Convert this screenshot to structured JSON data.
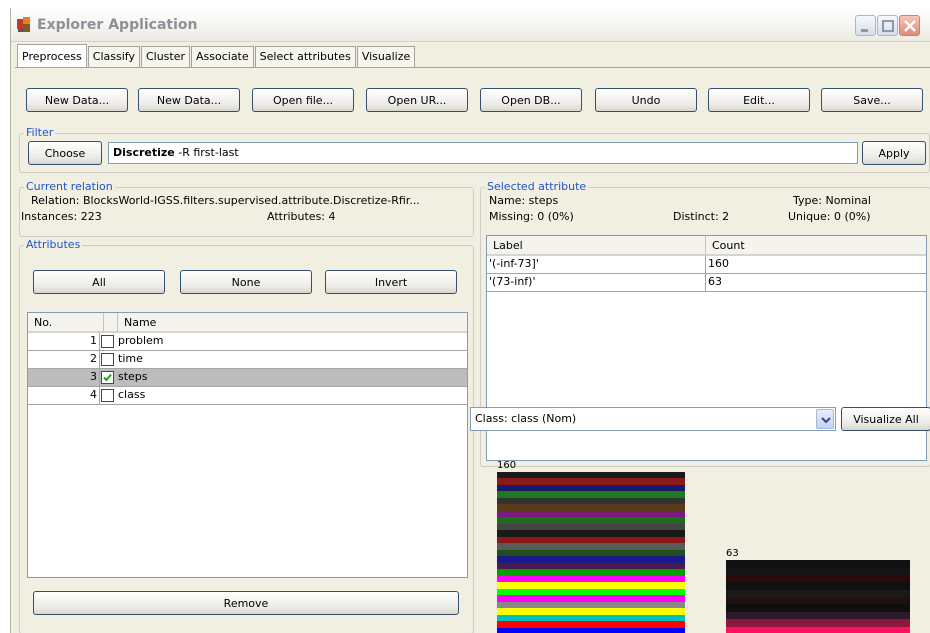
{
  "window": {
    "title": "Explorer Application"
  },
  "tabs": [
    {
      "label": "Preprocess",
      "active": true
    },
    {
      "label": "Classify"
    },
    {
      "label": "Cluster"
    },
    {
      "label": "Associate"
    },
    {
      "label": "Select attributes"
    },
    {
      "label": "Visualize"
    }
  ],
  "toolbar": {
    "buttons": [
      "New Data...",
      "New Data...",
      "Open file...",
      "Open UR...",
      "Open DB...",
      "Undo",
      "Edit...",
      "Save..."
    ]
  },
  "filter": {
    "title": "Filter",
    "choose_label": "Choose",
    "name": "Discretize",
    "options": " -R first-last",
    "apply_label": "Apply"
  },
  "current_relation": {
    "title": "Current relation",
    "relation_text": "Relation: BlocksWorld-IGSS.filters.supervised.attribute.Discretize-Rfir...",
    "instances_text": "Instances: 223",
    "attributes_text": "Attributes: 4"
  },
  "attributes_panel": {
    "title": "Attributes",
    "all_label": "All",
    "none_label": "None",
    "invert_label": "Invert",
    "col_no": "No.",
    "col_name": "Name",
    "rows": [
      {
        "no": "1",
        "name": "problem",
        "checked": false
      },
      {
        "no": "2",
        "name": "time",
        "checked": false
      },
      {
        "no": "3",
        "name": "steps",
        "checked": true
      },
      {
        "no": "4",
        "name": "class",
        "checked": false
      }
    ],
    "remove_label": "Remove"
  },
  "selected_attribute": {
    "title": "Selected attribute",
    "name_text": "Name: steps",
    "type_text": "Type: Nominal",
    "missing_text": "Missing: 0 (0%)",
    "distinct_text": "Distinct: 2",
    "unique_text": "Unique: 0 (0%)",
    "col_label": "Label",
    "col_count": "Count",
    "rows": [
      {
        "label": "'(-inf-73]'",
        "count": "160"
      },
      {
        "label": "'(73-inf)'",
        "count": "63"
      }
    ]
  },
  "class_selector": {
    "value": "Class: class (Nom)",
    "visualize_all_label": "Visualize All"
  },
  "histogram": {
    "bars": [
      {
        "label": "160",
        "value": 160
      },
      {
        "label": "63",
        "value": 63
      }
    ],
    "stripe_colors_1": [
      "#1a1a1a",
      "#8b1a1a",
      "#1a1a6b",
      "#1e7a1e",
      "#333333",
      "#5a3a1a",
      "#7a1a7a",
      "#1e6a1e",
      "#444444",
      "#1a1a1a",
      "#8b1a1a",
      "#5a5a5a",
      "#20501a",
      "#1a1a8a",
      "#4a1a4a",
      "#00a000",
      "#ff00ff",
      "#ffff00",
      "#00ff00",
      "#ff00ff",
      "#888888",
      "#ffff00",
      "#00c0c0",
      "#ff0000",
      "#0000ff"
    ],
    "stripe_colors_2": [
      "#111111",
      "#151515",
      "#2a0a0a",
      "#101010",
      "#1a1a1a",
      "#201010",
      "#0f0f0f",
      "#2a1a2a",
      "#8b1a3a",
      "#ff1060"
    ]
  }
}
